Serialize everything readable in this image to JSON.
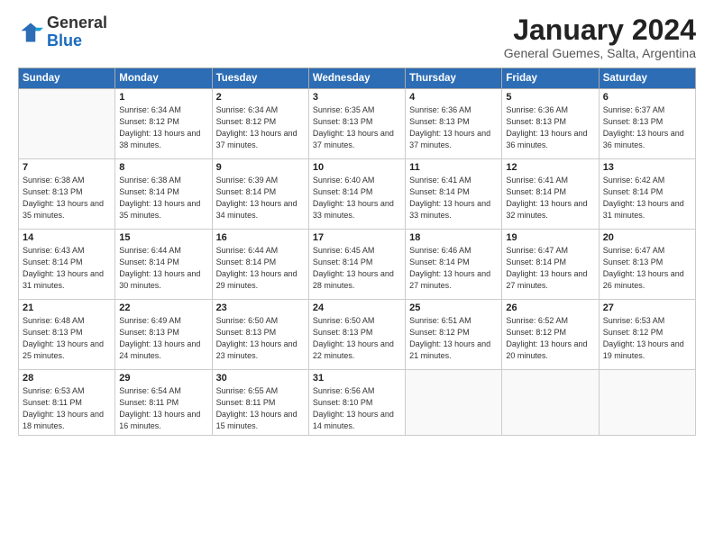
{
  "logo": {
    "general": "General",
    "blue": "Blue"
  },
  "header": {
    "month": "January 2024",
    "location": "General Guemes, Salta, Argentina"
  },
  "weekdays": [
    "Sunday",
    "Monday",
    "Tuesday",
    "Wednesday",
    "Thursday",
    "Friday",
    "Saturday"
  ],
  "weeks": [
    [
      {
        "day": "",
        "sunrise": "",
        "sunset": "",
        "daylight": ""
      },
      {
        "day": "1",
        "sunrise": "Sunrise: 6:34 AM",
        "sunset": "Sunset: 8:12 PM",
        "daylight": "Daylight: 13 hours and 38 minutes."
      },
      {
        "day": "2",
        "sunrise": "Sunrise: 6:34 AM",
        "sunset": "Sunset: 8:12 PM",
        "daylight": "Daylight: 13 hours and 37 minutes."
      },
      {
        "day": "3",
        "sunrise": "Sunrise: 6:35 AM",
        "sunset": "Sunset: 8:13 PM",
        "daylight": "Daylight: 13 hours and 37 minutes."
      },
      {
        "day": "4",
        "sunrise": "Sunrise: 6:36 AM",
        "sunset": "Sunset: 8:13 PM",
        "daylight": "Daylight: 13 hours and 37 minutes."
      },
      {
        "day": "5",
        "sunrise": "Sunrise: 6:36 AM",
        "sunset": "Sunset: 8:13 PM",
        "daylight": "Daylight: 13 hours and 36 minutes."
      },
      {
        "day": "6",
        "sunrise": "Sunrise: 6:37 AM",
        "sunset": "Sunset: 8:13 PM",
        "daylight": "Daylight: 13 hours and 36 minutes."
      }
    ],
    [
      {
        "day": "7",
        "sunrise": "Sunrise: 6:38 AM",
        "sunset": "Sunset: 8:13 PM",
        "daylight": "Daylight: 13 hours and 35 minutes."
      },
      {
        "day": "8",
        "sunrise": "Sunrise: 6:38 AM",
        "sunset": "Sunset: 8:14 PM",
        "daylight": "Daylight: 13 hours and 35 minutes."
      },
      {
        "day": "9",
        "sunrise": "Sunrise: 6:39 AM",
        "sunset": "Sunset: 8:14 PM",
        "daylight": "Daylight: 13 hours and 34 minutes."
      },
      {
        "day": "10",
        "sunrise": "Sunrise: 6:40 AM",
        "sunset": "Sunset: 8:14 PM",
        "daylight": "Daylight: 13 hours and 33 minutes."
      },
      {
        "day": "11",
        "sunrise": "Sunrise: 6:41 AM",
        "sunset": "Sunset: 8:14 PM",
        "daylight": "Daylight: 13 hours and 33 minutes."
      },
      {
        "day": "12",
        "sunrise": "Sunrise: 6:41 AM",
        "sunset": "Sunset: 8:14 PM",
        "daylight": "Daylight: 13 hours and 32 minutes."
      },
      {
        "day": "13",
        "sunrise": "Sunrise: 6:42 AM",
        "sunset": "Sunset: 8:14 PM",
        "daylight": "Daylight: 13 hours and 31 minutes."
      }
    ],
    [
      {
        "day": "14",
        "sunrise": "Sunrise: 6:43 AM",
        "sunset": "Sunset: 8:14 PM",
        "daylight": "Daylight: 13 hours and 31 minutes."
      },
      {
        "day": "15",
        "sunrise": "Sunrise: 6:44 AM",
        "sunset": "Sunset: 8:14 PM",
        "daylight": "Daylight: 13 hours and 30 minutes."
      },
      {
        "day": "16",
        "sunrise": "Sunrise: 6:44 AM",
        "sunset": "Sunset: 8:14 PM",
        "daylight": "Daylight: 13 hours and 29 minutes."
      },
      {
        "day": "17",
        "sunrise": "Sunrise: 6:45 AM",
        "sunset": "Sunset: 8:14 PM",
        "daylight": "Daylight: 13 hours and 28 minutes."
      },
      {
        "day": "18",
        "sunrise": "Sunrise: 6:46 AM",
        "sunset": "Sunset: 8:14 PM",
        "daylight": "Daylight: 13 hours and 27 minutes."
      },
      {
        "day": "19",
        "sunrise": "Sunrise: 6:47 AM",
        "sunset": "Sunset: 8:14 PM",
        "daylight": "Daylight: 13 hours and 27 minutes."
      },
      {
        "day": "20",
        "sunrise": "Sunrise: 6:47 AM",
        "sunset": "Sunset: 8:13 PM",
        "daylight": "Daylight: 13 hours and 26 minutes."
      }
    ],
    [
      {
        "day": "21",
        "sunrise": "Sunrise: 6:48 AM",
        "sunset": "Sunset: 8:13 PM",
        "daylight": "Daylight: 13 hours and 25 minutes."
      },
      {
        "day": "22",
        "sunrise": "Sunrise: 6:49 AM",
        "sunset": "Sunset: 8:13 PM",
        "daylight": "Daylight: 13 hours and 24 minutes."
      },
      {
        "day": "23",
        "sunrise": "Sunrise: 6:50 AM",
        "sunset": "Sunset: 8:13 PM",
        "daylight": "Daylight: 13 hours and 23 minutes."
      },
      {
        "day": "24",
        "sunrise": "Sunrise: 6:50 AM",
        "sunset": "Sunset: 8:13 PM",
        "daylight": "Daylight: 13 hours and 22 minutes."
      },
      {
        "day": "25",
        "sunrise": "Sunrise: 6:51 AM",
        "sunset": "Sunset: 8:12 PM",
        "daylight": "Daylight: 13 hours and 21 minutes."
      },
      {
        "day": "26",
        "sunrise": "Sunrise: 6:52 AM",
        "sunset": "Sunset: 8:12 PM",
        "daylight": "Daylight: 13 hours and 20 minutes."
      },
      {
        "day": "27",
        "sunrise": "Sunrise: 6:53 AM",
        "sunset": "Sunset: 8:12 PM",
        "daylight": "Daylight: 13 hours and 19 minutes."
      }
    ],
    [
      {
        "day": "28",
        "sunrise": "Sunrise: 6:53 AM",
        "sunset": "Sunset: 8:11 PM",
        "daylight": "Daylight: 13 hours and 18 minutes."
      },
      {
        "day": "29",
        "sunrise": "Sunrise: 6:54 AM",
        "sunset": "Sunset: 8:11 PM",
        "daylight": "Daylight: 13 hours and 16 minutes."
      },
      {
        "day": "30",
        "sunrise": "Sunrise: 6:55 AM",
        "sunset": "Sunset: 8:11 PM",
        "daylight": "Daylight: 13 hours and 15 minutes."
      },
      {
        "day": "31",
        "sunrise": "Sunrise: 6:56 AM",
        "sunset": "Sunset: 8:10 PM",
        "daylight": "Daylight: 13 hours and 14 minutes."
      },
      {
        "day": "",
        "sunrise": "",
        "sunset": "",
        "daylight": ""
      },
      {
        "day": "",
        "sunrise": "",
        "sunset": "",
        "daylight": ""
      },
      {
        "day": "",
        "sunrise": "",
        "sunset": "",
        "daylight": ""
      }
    ]
  ]
}
